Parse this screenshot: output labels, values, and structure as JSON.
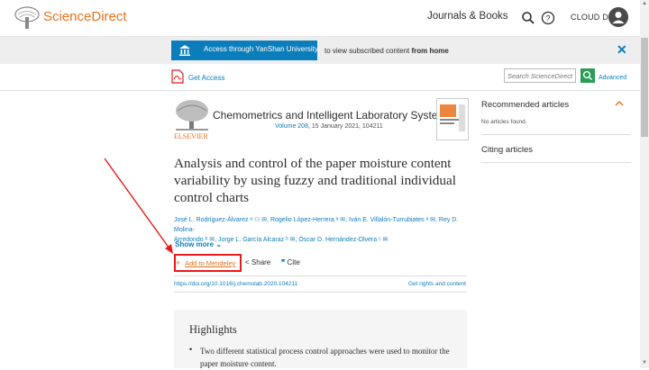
{
  "header": {
    "brand": "ScienceDirect",
    "nav_journals": "Journals & Books",
    "user_name": "CLOUD DU"
  },
  "banner": {
    "access_label": "Access through YanShan University",
    "subtext_prefix": "to view subscribed content ",
    "subtext_bold": "from home",
    "close": "✕"
  },
  "toolbar": {
    "get_access": "Get Access",
    "search_placeholder": "Search ScienceDirect",
    "advanced": "Advanced"
  },
  "journal": {
    "publisher": "ELSEVIER",
    "title": "Chemometrics and Intelligent Laboratory Systems",
    "volume": "Volume 208",
    "volume_rest": ", 15 January 2021, 104211"
  },
  "article": {
    "title": "Analysis and control of the paper moisture content variability by using fuzzy and traditional individual control charts",
    "authors_line1": "José L. Rodríguez-Álvarez ᵃ ⚇ ✉, Rogelio López-Herrera ᵃ ✉, Iván E. Villalón-Turrubiates ᵃ ✉, Rey D. Molina-",
    "authors_line2": "Arredondo ᵇ ✉, Jorge L. García Alcaraz ᵇ ✉, Óscar D. Hernández-Olvera ᶜ ✉",
    "show_more": "Show more",
    "add_mendeley": "Add to Mendeley",
    "share": "Share",
    "cite": "Cite",
    "doi": "https://doi.org/10.1016/j.chemolab.2020.104211",
    "rights": "Get rights and content"
  },
  "highlights": {
    "title": "Highlights",
    "bullet": "•",
    "item": "Two different statistical process control approaches were used to monitor the paper moisture content."
  },
  "sidebar": {
    "recommended_title": "Recommended articles",
    "recommended_empty": "No articles found.",
    "citing_title": "Citing articles"
  },
  "colors": {
    "brand_orange": "#e9711c",
    "link_blue": "#0c7dbb",
    "annotation_red": "#e81a1a"
  }
}
